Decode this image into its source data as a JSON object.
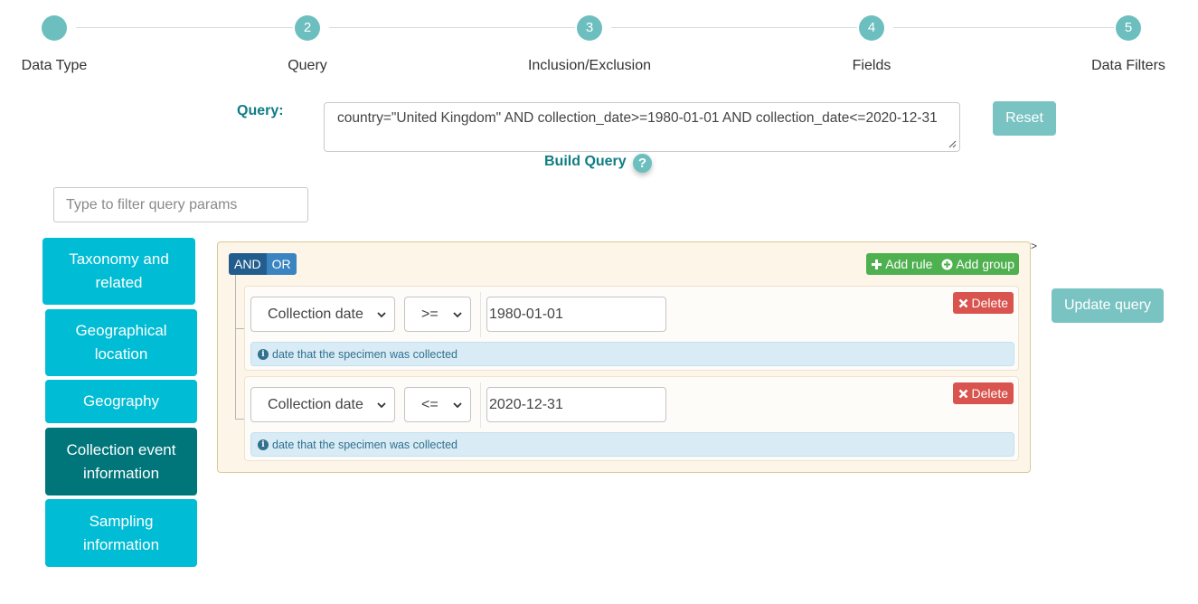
{
  "stepper": {
    "steps": [
      {
        "number": "",
        "label": "Data Type"
      },
      {
        "number": "2",
        "label": "Query"
      },
      {
        "number": "3",
        "label": "Inclusion/Exclusion"
      },
      {
        "number": "4",
        "label": "Fields"
      },
      {
        "number": "5",
        "label": "Data Filters"
      }
    ]
  },
  "query": {
    "label": "Query:",
    "text": "country=\"United Kingdom\" AND collection_date>=1980-01-01 AND collection_date<=2020-12-31",
    "reset_label": "Reset",
    "build_label": "Build Query",
    "help_glyph": "?"
  },
  "filter": {
    "placeholder": "Type to filter query params"
  },
  "sidebar": {
    "items": [
      {
        "label": "Taxonomy and related"
      },
      {
        "label": "Geographical location"
      },
      {
        "label": "Geography"
      },
      {
        "label": "Collection event information",
        "active": true
      },
      {
        "label": "Sampling information"
      }
    ]
  },
  "builder": {
    "and_label": "AND",
    "or_label": "OR",
    "add_rule_label": "Add rule",
    "add_group_label": "Add group",
    "stray_mark": ">",
    "rules": [
      {
        "field": "Collection date",
        "operator": ">=",
        "value": "1980-01-01",
        "delete_label": "Delete",
        "info": "date that the specimen was collected"
      },
      {
        "field": "Collection date",
        "operator": "<=",
        "value": "2020-12-31",
        "delete_label": "Delete",
        "info": "date that the specimen was collected"
      }
    ]
  },
  "update_label": "Update query",
  "colors": {
    "teal": "#6cbfbe",
    "teal_text": "#0f7d84",
    "sidebar": "#00bcd4",
    "sidebar_active": "#00767b",
    "and": "#235d8e",
    "or": "#3a84c1",
    "add": "#4fb04f",
    "delete": "#d9534f",
    "builder_bg": "#fcf5e8"
  }
}
